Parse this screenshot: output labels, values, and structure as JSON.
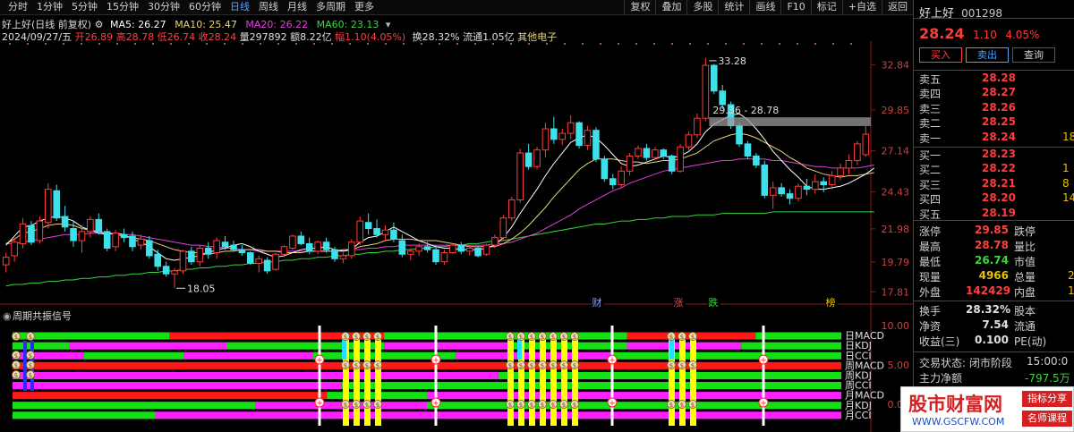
{
  "toolbar": {
    "periods": [
      "分时",
      "1分钟",
      "5分钟",
      "15分钟",
      "30分钟",
      "60分钟",
      "日线",
      "周线",
      "月线",
      "多周期",
      "更多"
    ],
    "active_period": "日线",
    "tools": [
      "复权",
      "叠加",
      "多股",
      "统计",
      "画线",
      "F10",
      "标记",
      "+自选",
      "返回"
    ]
  },
  "info": {
    "title": "好上好(日线 前复权)",
    "ma5": "MA5: 26.27",
    "ma10": "MA10: 25.47",
    "ma20": "MA20: 26.22",
    "ma60": "MA60: 23.13",
    "date": "2024/09/27/五",
    "open": "开26.89",
    "high": "高28.78",
    "low": "低26.74",
    "close": "收28.24",
    "volume": "量297892",
    "amount": "额8.22亿",
    "change": "幅1.10(4.05%)",
    "turnover": "换28.32%",
    "float": "流通1.05亿",
    "sector": "其他电子"
  },
  "price_axis": [
    "32.84",
    "29.85",
    "27.14",
    "24.43",
    "21.98",
    "19.79",
    "17.81"
  ],
  "osc_axis": [
    "10.00",
    "5.00",
    "0.00"
  ],
  "annotations": {
    "high": "33.28",
    "low": "18.05",
    "range": "29.36 - 28.78"
  },
  "event_labels": [
    "财",
    "涨",
    "跌",
    "榜"
  ],
  "panel": {
    "title": "周期共振信号"
  },
  "signal_labels": [
    "日MACD",
    "日KDJ",
    "日CCI",
    "周MACD",
    "周KDJ",
    "周CCI",
    "月MACD",
    "月KDJ",
    "月CCI"
  ],
  "colors": {
    "up": "#ff3b3b",
    "down": "#3ee0ea",
    "ma5": "#ffffff",
    "ma10": "#e8d27a",
    "ma20": "#e040e0",
    "ma60": "#39d639",
    "sig_red": "#ff1818",
    "sig_green": "#14e014",
    "sig_magenta": "#ff20ff"
  },
  "chart_data": {
    "type": "candlestick",
    "ohlc": [
      [
        19.6,
        20.4,
        19.1,
        20.1
      ],
      [
        20.2,
        21.4,
        19.8,
        21.1
      ],
      [
        21.0,
        22.7,
        20.7,
        22.3
      ],
      [
        22.2,
        22.5,
        20.9,
        21.1
      ],
      [
        21.2,
        22.8,
        21.0,
        22.5
      ],
      [
        22.4,
        25.0,
        22.0,
        24.6
      ],
      [
        24.5,
        24.9,
        22.5,
        22.7
      ],
      [
        22.8,
        23.5,
        21.8,
        22.1
      ],
      [
        22.0,
        22.5,
        20.8,
        21.2
      ],
      [
        21.2,
        22.2,
        20.4,
        21.8
      ],
      [
        21.8,
        22.8,
        21.4,
        22.6
      ],
      [
        22.6,
        23.0,
        21.6,
        21.8
      ],
      [
        21.8,
        22.0,
        20.5,
        20.7
      ],
      [
        20.8,
        21.9,
        20.5,
        21.7
      ],
      [
        21.6,
        22.0,
        21.1,
        21.4
      ],
      [
        21.5,
        21.8,
        20.5,
        20.8
      ],
      [
        20.9,
        21.6,
        20.6,
        21.3
      ],
      [
        21.2,
        21.5,
        20.0,
        20.2
      ],
      [
        20.3,
        20.6,
        19.2,
        19.5
      ],
      [
        19.5,
        19.8,
        18.8,
        19.0
      ],
      [
        19.0,
        19.4,
        18.05,
        19.2
      ],
      [
        19.2,
        20.6,
        19.0,
        20.5
      ],
      [
        20.5,
        20.8,
        19.6,
        19.8
      ],
      [
        19.8,
        20.9,
        19.5,
        20.7
      ],
      [
        20.7,
        21.1,
        20.0,
        20.3
      ],
      [
        20.4,
        21.4,
        20.0,
        21.2
      ],
      [
        21.1,
        21.5,
        20.6,
        20.8
      ],
      [
        20.9,
        21.2,
        20.5,
        20.6
      ],
      [
        20.6,
        20.9,
        20.2,
        20.4
      ],
      [
        20.4,
        20.5,
        19.6,
        19.7
      ],
      [
        19.7,
        20.2,
        19.1,
        20.0
      ],
      [
        19.9,
        20.1,
        19.0,
        19.2
      ],
      [
        19.3,
        20.4,
        19.2,
        20.3
      ],
      [
        20.3,
        20.9,
        20.1,
        20.8
      ],
      [
        20.7,
        21.6,
        20.6,
        21.5
      ],
      [
        21.5,
        21.8,
        20.9,
        21.0
      ],
      [
        21.0,
        21.4,
        20.3,
        20.5
      ],
      [
        20.5,
        21.2,
        20.3,
        21.1
      ],
      [
        21.1,
        21.4,
        20.4,
        20.6
      ],
      [
        20.6,
        20.8,
        19.8,
        20.0
      ],
      [
        20.0,
        20.4,
        19.7,
        20.2
      ],
      [
        20.2,
        21.3,
        20.0,
        21.1
      ],
      [
        21.1,
        22.8,
        20.9,
        22.5
      ],
      [
        22.4,
        23.0,
        21.6,
        22.0
      ],
      [
        22.0,
        22.6,
        21.4,
        21.6
      ],
      [
        21.6,
        22.2,
        21.2,
        21.9
      ],
      [
        21.9,
        22.4,
        21.1,
        21.3
      ],
      [
        21.2,
        21.6,
        20.1,
        20.3
      ],
      [
        20.3,
        20.7,
        19.9,
        20.5
      ],
      [
        20.5,
        21.0,
        20.2,
        20.8
      ],
      [
        20.8,
        21.1,
        20.4,
        20.6
      ],
      [
        20.6,
        20.9,
        19.6,
        19.8
      ],
      [
        19.8,
        20.6,
        19.6,
        20.4
      ],
      [
        20.4,
        21.0,
        20.3,
        20.9
      ],
      [
        20.9,
        21.1,
        20.3,
        20.5
      ],
      [
        20.5,
        20.9,
        20.2,
        20.7
      ],
      [
        20.7,
        20.8,
        20.1,
        20.2
      ],
      [
        20.3,
        21.0,
        20.2,
        20.9
      ],
      [
        20.9,
        21.6,
        20.7,
        21.4
      ],
      [
        21.4,
        22.9,
        21.2,
        22.7
      ],
      [
        22.7,
        24.1,
        22.5,
        23.9
      ],
      [
        23.9,
        27.3,
        23.7,
        27.0
      ],
      [
        27.0,
        27.6,
        25.9,
        26.1
      ],
      [
        26.1,
        27.4,
        25.9,
        27.2
      ],
      [
        27.2,
        29.0,
        26.7,
        28.6
      ],
      [
        28.6,
        29.4,
        27.6,
        27.9
      ],
      [
        27.9,
        28.6,
        27.5,
        28.3
      ],
      [
        28.3,
        29.5,
        27.9,
        29.0
      ],
      [
        29.0,
        29.1,
        27.3,
        27.5
      ],
      [
        27.5,
        28.8,
        27.2,
        28.5
      ],
      [
        28.5,
        28.7,
        26.4,
        26.6
      ],
      [
        26.6,
        26.8,
        25.1,
        25.3
      ],
      [
        25.3,
        25.6,
        24.6,
        24.9
      ],
      [
        24.9,
        26.1,
        24.7,
        25.8
      ],
      [
        25.8,
        27.0,
        25.5,
        26.8
      ],
      [
        26.8,
        27.5,
        26.6,
        27.3
      ],
      [
        27.3,
        27.6,
        26.5,
        26.7
      ],
      [
        26.7,
        27.4,
        26.6,
        27.2
      ],
      [
        27.2,
        27.3,
        26.6,
        26.8
      ],
      [
        26.8,
        26.9,
        25.6,
        25.8
      ],
      [
        25.8,
        27.6,
        25.7,
        27.4
      ],
      [
        27.4,
        28.4,
        27.2,
        28.2
      ],
      [
        28.2,
        29.6,
        28.0,
        29.3
      ],
      [
        29.3,
        33.28,
        29.1,
        32.8
      ],
      [
        32.8,
        32.9,
        30.9,
        31.1
      ],
      [
        31.1,
        31.5,
        29.9,
        30.2
      ],
      [
        30.2,
        30.4,
        28.6,
        28.8
      ],
      [
        28.8,
        29.0,
        27.4,
        27.6
      ],
      [
        27.6,
        27.8,
        26.6,
        26.8
      ],
      [
        26.8,
        27.0,
        26.0,
        26.2
      ],
      [
        26.2,
        26.5,
        24.0,
        24.2
      ],
      [
        24.2,
        25.1,
        23.3,
        24.7
      ],
      [
        24.7,
        25.0,
        24.1,
        24.3
      ],
      [
        24.3,
        24.6,
        23.6,
        24.0
      ],
      [
        24.0,
        25.0,
        23.8,
        24.8
      ],
      [
        24.8,
        25.3,
        24.2,
        24.6
      ],
      [
        24.6,
        25.6,
        24.3,
        25.1
      ],
      [
        25.1,
        25.4,
        24.4,
        24.9
      ],
      [
        24.9,
        25.8,
        24.6,
        25.5
      ],
      [
        25.5,
        26.3,
        25.2,
        26.0
      ],
      [
        26.0,
        26.9,
        25.6,
        26.5
      ],
      [
        26.5,
        27.8,
        26.2,
        27.6
      ],
      [
        26.89,
        28.78,
        26.74,
        28.24
      ]
    ],
    "ma5": [
      20.9,
      21.5,
      22.1,
      22.2,
      22.5,
      22.7,
      22.8,
      22.7,
      22.5,
      22.1,
      21.9,
      21.7,
      21.6,
      21.7,
      21.6,
      21.3,
      21.1,
      20.8,
      20.4,
      20.0,
      19.9,
      20.0,
      20.1,
      20.2,
      20.4,
      20.6,
      20.7,
      20.9,
      21.0,
      20.8,
      20.5,
      20.3,
      20.1,
      20.2,
      20.4,
      20.6,
      20.7,
      20.7,
      20.8,
      20.6,
      20.5,
      20.6,
      21.1,
      21.4,
      21.5,
      21.8,
      22.1,
      21.8,
      21.5,
      21.2,
      21.0,
      20.8,
      20.7,
      20.7,
      20.6,
      20.6,
      20.6,
      20.7,
      20.9,
      21.4,
      22.1,
      23.0,
      23.8,
      24.6,
      25.5,
      26.3,
      27.0,
      27.7,
      28.0,
      28.2,
      28.0,
      27.5,
      26.9,
      26.3,
      26.1,
      26.2,
      26.4,
      26.6,
      26.8,
      26.7,
      26.8,
      27.1,
      27.6,
      28.4,
      28.9,
      29.2,
      29.5,
      29.6,
      29.2,
      28.6,
      27.9,
      27.1,
      26.5,
      25.9,
      25.4,
      24.8,
      24.6,
      24.6,
      24.7,
      24.8,
      25.0,
      25.3,
      25.6,
      26.0
    ],
    "ma10": [
      21.0,
      21.3,
      21.7,
      21.8,
      22.0,
      22.2,
      22.3,
      22.3,
      22.2,
      22.0,
      21.9,
      21.8,
      21.7,
      21.6,
      21.5,
      21.4,
      21.3,
      21.2,
      21.0,
      20.8,
      20.6,
      20.5,
      20.4,
      20.4,
      20.3,
      20.4,
      20.5,
      20.5,
      20.6,
      20.6,
      20.6,
      20.5,
      20.5,
      20.4,
      20.4,
      20.4,
      20.5,
      20.5,
      20.5,
      20.5,
      20.6,
      20.6,
      20.8,
      20.9,
      21.0,
      21.2,
      21.3,
      21.3,
      21.3,
      21.2,
      21.2,
      21.2,
      21.1,
      21.0,
      20.9,
      20.8,
      20.8,
      20.8,
      20.8,
      21.0,
      21.3,
      21.7,
      22.2,
      22.8,
      23.4,
      24.1,
      24.7,
      25.3,
      25.9,
      26.3,
      26.6,
      26.6,
      26.6,
      26.5,
      26.4,
      26.4,
      26.3,
      26.4,
      26.5,
      26.5,
      26.6,
      26.8,
      27.0,
      27.4,
      27.8,
      28.0,
      28.2,
      28.3,
      28.2,
      28.0,
      27.7,
      27.4,
      27.1,
      26.7,
      26.4,
      26.0,
      25.8,
      25.6,
      25.5,
      25.4,
      25.5,
      25.5,
      25.6,
      25.7
    ],
    "ma20": [
      21.0,
      21.0,
      21.1,
      21.2,
      21.3,
      21.4,
      21.5,
      21.6,
      21.6,
      21.6,
      21.7,
      21.7,
      21.7,
      21.7,
      21.6,
      21.6,
      21.5,
      21.4,
      21.3,
      21.2,
      21.1,
      21.0,
      20.9,
      20.9,
      20.8,
      20.8,
      20.7,
      20.7,
      20.6,
      20.6,
      20.5,
      20.5,
      20.5,
      20.5,
      20.5,
      20.5,
      20.5,
      20.5,
      20.5,
      20.5,
      20.5,
      20.6,
      20.6,
      20.7,
      20.7,
      20.8,
      20.8,
      20.9,
      20.9,
      20.9,
      20.9,
      20.9,
      20.9,
      20.9,
      20.9,
      20.9,
      20.9,
      20.9,
      21.0,
      21.0,
      21.1,
      21.3,
      21.5,
      21.7,
      22.0,
      22.3,
      22.6,
      22.9,
      23.3,
      23.6,
      23.9,
      24.2,
      24.5,
      24.7,
      25.0,
      25.2,
      25.4,
      25.6,
      25.8,
      25.9,
      26.0,
      26.1,
      26.2,
      26.3,
      26.4,
      26.5,
      26.5,
      26.6,
      26.6,
      26.6,
      26.6,
      26.5,
      26.5,
      26.4,
      26.3,
      26.2,
      26.1,
      26.1,
      26.0,
      26.0,
      26.0,
      26.0,
      26.1,
      26.2
    ],
    "ma60": [
      18.2,
      18.3,
      18.3,
      18.4,
      18.4,
      18.5,
      18.5,
      18.6,
      18.6,
      18.7,
      18.7,
      18.8,
      18.8,
      18.9,
      18.9,
      19.0,
      19.0,
      19.1,
      19.1,
      19.2,
      19.2,
      19.3,
      19.3,
      19.4,
      19.4,
      19.5,
      19.5,
      19.6,
      19.6,
      19.7,
      19.7,
      19.8,
      19.8,
      19.9,
      19.9,
      20.0,
      20.0,
      20.1,
      20.1,
      20.2,
      20.2,
      20.3,
      20.3,
      20.4,
      20.4,
      20.5,
      20.5,
      20.6,
      20.6,
      20.7,
      20.7,
      20.8,
      20.8,
      20.9,
      20.9,
      21.0,
      21.0,
      21.1,
      21.2,
      21.2,
      21.3,
      21.4,
      21.5,
      21.6,
      21.7,
      21.8,
      21.9,
      22.0,
      22.1,
      22.2,
      22.3,
      22.3,
      22.4,
      22.5,
      22.5,
      22.6,
      22.6,
      22.7,
      22.7,
      22.8,
      22.8,
      22.8,
      22.9,
      22.9,
      22.9,
      23.0,
      23.0,
      23.0,
      23.0,
      23.0,
      23.0,
      23.1,
      23.1,
      23.1,
      23.1,
      23.1,
      23.1,
      23.1,
      23.1,
      23.1,
      23.1,
      23.1,
      23.1,
      23.1
    ],
    "signal_rows": {
      "日MACD": [
        "G",
        22,
        "R",
        30,
        "G",
        34,
        "R",
        18,
        "G",
        12
      ],
      "日KDJ": [
        "G",
        8,
        "M",
        22,
        "G",
        22,
        "M",
        18,
        "G",
        16,
        "M",
        16,
        "G",
        14
      ],
      "日CCI": [
        "M",
        10,
        "G",
        14,
        "M",
        18,
        "G",
        20,
        "M",
        22,
        "G",
        32
      ],
      "周MACD": [
        "R",
        116
      ],
      "周KDJ": [
        "M",
        68,
        "G",
        48
      ],
      "周CCI": [
        "M",
        46,
        "G",
        70
      ],
      "月MACD": [
        "R",
        44,
        "G",
        14,
        "M",
        58
      ],
      "月KDJ": [
        "G",
        34,
        "M",
        24,
        "G",
        58
      ],
      "月CCI": [
        "G",
        20,
        "M",
        96
      ]
    }
  },
  "quote": {
    "name": "好上好",
    "code": "001298",
    "price": "28.24",
    "change": "1.10",
    "change_pct": "4.05%",
    "buttons": [
      "买入",
      "卖出",
      "查询"
    ],
    "asks": [
      {
        "label": "卖五",
        "price": "28.28"
      },
      {
        "label": "卖四",
        "price": "28.27"
      },
      {
        "label": "卖三",
        "price": "28.26"
      },
      {
        "label": "卖二",
        "price": "28.25"
      },
      {
        "label": "卖一",
        "price": "28.24",
        "vol": "18"
      }
    ],
    "bids": [
      {
        "label": "买一",
        "price": "28.23"
      },
      {
        "label": "买二",
        "price": "28.22",
        "vol": "1"
      },
      {
        "label": "买三",
        "price": "28.21",
        "vol": "8"
      },
      {
        "label": "买四",
        "price": "28.20",
        "vol": "14"
      },
      {
        "label": "买五",
        "price": "28.19"
      }
    ],
    "stats": [
      [
        "涨停",
        "29.85",
        "跌停",
        ""
      ],
      [
        "最高",
        "28.78",
        "量比",
        ""
      ],
      [
        "最低",
        "26.74",
        "市值",
        ""
      ],
      [
        "现量",
        "4966",
        "总量",
        "2"
      ],
      [
        "外盘",
        "142429",
        "内盘",
        "1"
      ]
    ],
    "stats2": [
      [
        "换手",
        "28.32%",
        "股本",
        ""
      ],
      [
        "净资",
        "7.54",
        "流通",
        ""
      ],
      [
        "收益(三)",
        "0.100",
        "PE(动)",
        ""
      ]
    ],
    "trade_status": "交易状态: 闭市阶段",
    "trade_time": "15:00:0",
    "main_flow": "主力净额",
    "main_flow_value": "-797.5万"
  },
  "watermark": {
    "name": "股市财富网",
    "url": "WWW.GSCFW.COM",
    "btn1": "指标分享",
    "btn2": "名师课程"
  }
}
